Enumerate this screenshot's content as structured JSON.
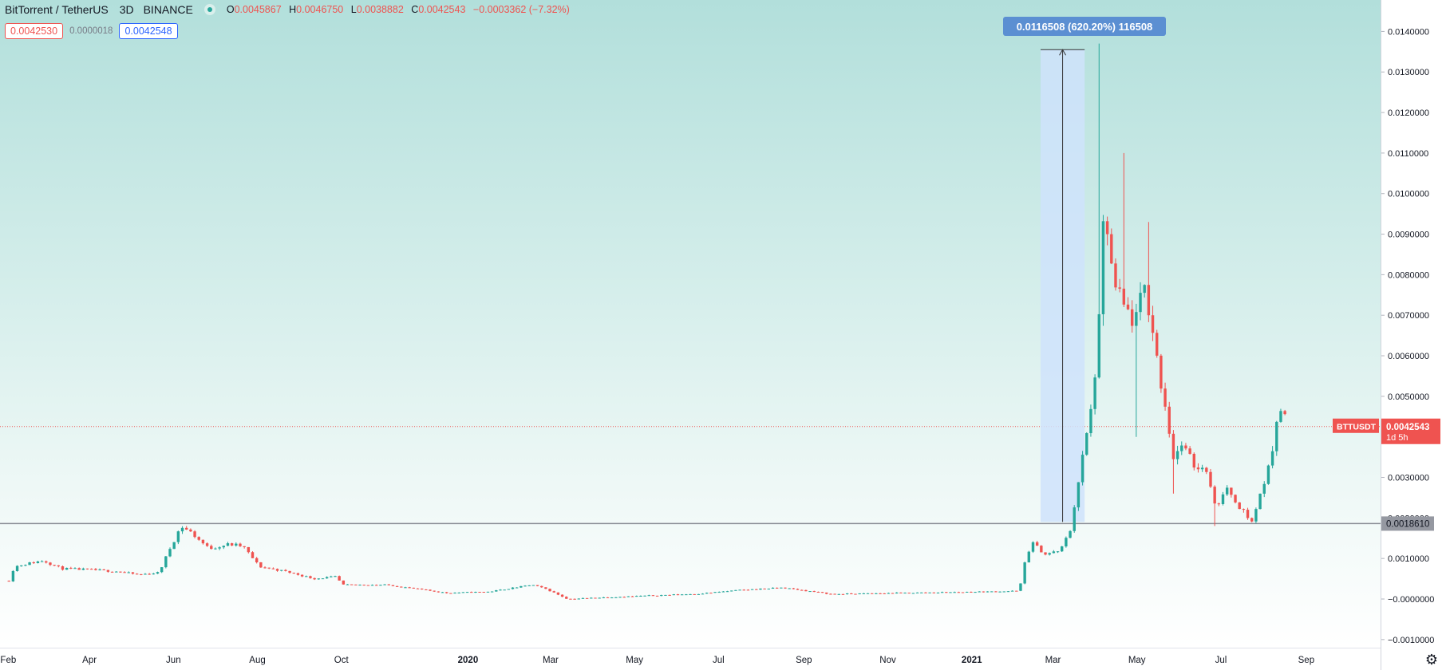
{
  "header": {
    "symbol": "BitTorrent / TetherUS",
    "timeframe": "3D",
    "exchange": "BINANCE",
    "open_label": "O",
    "open": "0.0045867",
    "high_label": "H",
    "high": "0.0046750",
    "low_label": "L",
    "low": "0.0038882",
    "close_label": "C",
    "close": "0.0042543",
    "change": "−0.0003362 (−7.32%)"
  },
  "quotes": {
    "sell": "0.0042530",
    "spread": "0.0000018",
    "buy": "0.0042548"
  },
  "measure": {
    "label": "0.0116508 (620.20%) 116508"
  },
  "price_badge": {
    "symbol": "BTTUSDT",
    "price": "0.0042543",
    "countdown": "1d 5h"
  },
  "hline_badge": {
    "price": "0.0018610"
  },
  "settings_icon": "gear-icon",
  "colors": {
    "up": "#26a69a",
    "down": "#ef5350",
    "accent": "#5b8fd2",
    "background_top": "#b2dfdb"
  },
  "chart_data": {
    "type": "candlestick",
    "title": "",
    "xlabel": "",
    "ylabel": "",
    "ylim": [
      -0.0012,
      0.0145
    ],
    "y_ticks": [
      "0.0140000",
      "0.0130000",
      "0.0120000",
      "0.0110000",
      "0.0100000",
      "0.0090000",
      "0.0080000",
      "0.0070000",
      "0.0060000",
      "0.0050000",
      "0.0030000",
      "0.0020000",
      "0.0010000",
      "−0.0000000",
      "−0.0010000"
    ],
    "y_tick_values": [
      0.014,
      0.013,
      0.012,
      0.011,
      0.01,
      0.009,
      0.008,
      0.007,
      0.006,
      0.005,
      0.003,
      0.002,
      0.001,
      0,
      -0.001
    ],
    "x_ticks": [
      "Feb",
      "Apr",
      "Jun",
      "Aug",
      "Oct",
      "2020",
      "Mar",
      "May",
      "Jul",
      "Sep",
      "Nov",
      "2021",
      "Mar",
      "May",
      "Jul",
      "Sep"
    ],
    "x_tick_dates": [
      "2019-02-01",
      "2019-04-01",
      "2019-06-01",
      "2019-08-01",
      "2019-10-01",
      "2020-01-01",
      "2020-03-01",
      "2020-05-01",
      "2020-07-01",
      "2020-09-01",
      "2020-11-01",
      "2021-01-01",
      "2021-03-01",
      "2021-05-01",
      "2021-07-01",
      "2021-09-01"
    ],
    "x_range": [
      "2019-01-26",
      "2021-10-25"
    ],
    "grid": false,
    "horizontal_line": 0.001861,
    "current_price": 0.0042543,
    "measure": {
      "from_date": "2021-02-20",
      "to_date": "2021-03-24",
      "from_price": 0.0019,
      "to_price": 0.0135508
    },
    "anchors": [
      [
        "2019-01-31",
        0.00045
      ],
      [
        "2019-02-04",
        0.0008
      ],
      [
        "2019-02-10",
        0.00085
      ],
      [
        "2019-02-25",
        0.00095
      ],
      [
        "2019-03-10",
        0.00075
      ],
      [
        "2019-04-01",
        0.00072
      ],
      [
        "2019-04-20",
        0.00068
      ],
      [
        "2019-05-05",
        0.0006
      ],
      [
        "2019-05-20",
        0.00065
      ],
      [
        "2019-05-28",
        0.00125
      ],
      [
        "2019-06-05",
        0.0018
      ],
      [
        "2019-06-12",
        0.00165
      ],
      [
        "2019-06-25",
        0.00125
      ],
      [
        "2019-07-10",
        0.00135
      ],
      [
        "2019-07-20",
        0.0013
      ],
      [
        "2019-08-01",
        0.0008
      ],
      [
        "2019-08-20",
        0.00068
      ],
      [
        "2019-09-10",
        0.0005
      ],
      [
        "2019-09-25",
        0.00055
      ],
      [
        "2019-10-01",
        0.00035
      ],
      [
        "2019-11-01",
        0.00035
      ],
      [
        "2019-12-15",
        0.00015
      ],
      [
        "2020-01-15",
        0.00018
      ],
      [
        "2020-02-15",
        0.00035
      ],
      [
        "2020-02-25",
        0.00025
      ],
      [
        "2020-03-12",
        0.0
      ],
      [
        "2020-04-15",
        5e-05
      ],
      [
        "2020-06-15",
        0.00013
      ],
      [
        "2020-07-15",
        0.00022
      ],
      [
        "2020-08-15",
        0.00028
      ],
      [
        "2020-09-20",
        0.00012
      ],
      [
        "2020-11-10",
        0.00015
      ],
      [
        "2021-01-10",
        0.00018
      ],
      [
        "2021-02-03",
        0.0002
      ],
      [
        "2021-02-07",
        0.0009
      ],
      [
        "2021-02-12",
        0.0014
      ],
      [
        "2021-02-22",
        0.0011
      ],
      [
        "2021-03-05",
        0.0012
      ],
      [
        "2021-03-12",
        0.0017
      ],
      [
        "2021-03-20",
        0.0033
      ],
      [
        "2021-03-28",
        0.0048
      ],
      [
        "2021-04-02",
        0.0068
      ],
      [
        "2021-04-06",
        0.0098
      ],
      [
        "2021-04-12",
        0.0078
      ],
      [
        "2021-04-20",
        0.0072
      ],
      [
        "2021-04-28",
        0.0068
      ],
      [
        "2021-05-05",
        0.0077
      ],
      [
        "2021-05-10",
        0.0068
      ],
      [
        "2021-05-16",
        0.0055
      ],
      [
        "2021-05-20",
        0.0048
      ],
      [
        "2021-05-26",
        0.0035
      ],
      [
        "2021-06-01",
        0.0038
      ],
      [
        "2021-06-10",
        0.0033
      ],
      [
        "2021-06-20",
        0.0032
      ],
      [
        "2021-06-25",
        0.0023
      ],
      [
        "2021-07-05",
        0.0027
      ],
      [
        "2021-07-15",
        0.0022
      ],
      [
        "2021-07-22",
        0.0019
      ],
      [
        "2021-07-30",
        0.0028
      ],
      [
        "2021-08-05",
        0.0034
      ],
      [
        "2021-08-10",
        0.0048
      ],
      [
        "2021-08-14",
        0.0046
      ],
      [
        "2021-08-17",
        0.00425
      ]
    ],
    "spikes": [
      {
        "date": "2021-04-03",
        "high": 0.0137
      },
      {
        "date": "2021-04-21",
        "high": 0.011
      },
      {
        "date": "2021-05-10",
        "high": 0.0093
      },
      {
        "date": "2021-04-30",
        "low": 0.004
      },
      {
        "date": "2021-05-27",
        "low": 0.0026
      },
      {
        "date": "2021-06-25",
        "low": 0.0018
      }
    ]
  }
}
